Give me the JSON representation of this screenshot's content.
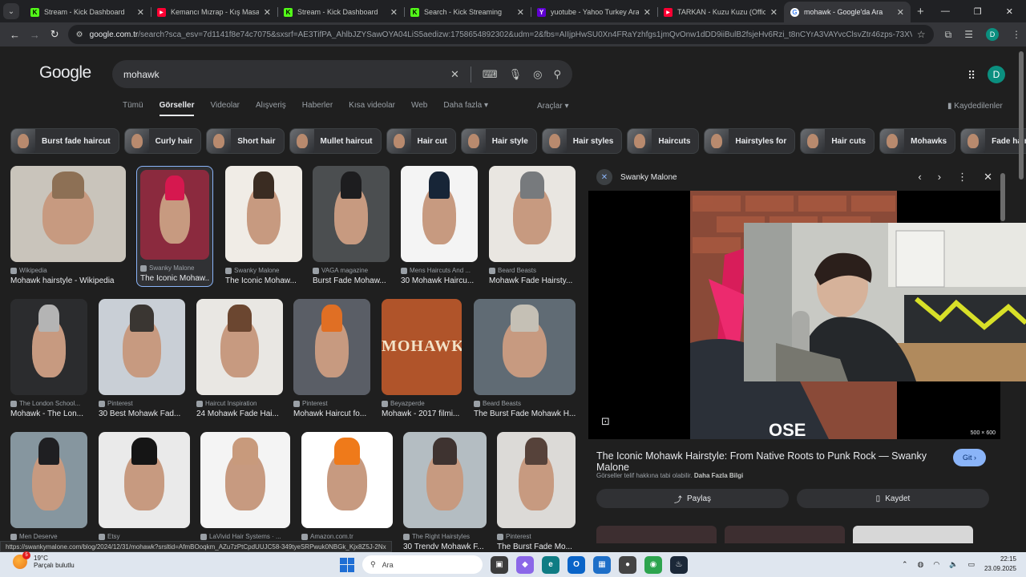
{
  "browser": {
    "tabs": [
      {
        "title": "Stream - Kick Dashboard",
        "icon": "kick-icon"
      },
      {
        "title": "Kemancı Mızrap - Kış Masalı - Y",
        "icon": "youtube-icon"
      },
      {
        "title": "Stream - Kick Dashboard",
        "icon": "kick-icon"
      },
      {
        "title": "Search - Kick Streaming",
        "icon": "kick-icon"
      },
      {
        "title": "yuotube - Yahoo Turkey Arama",
        "icon": "yahoo-icon"
      },
      {
        "title": "TARKAN - Kuzu Kuzu (Official M",
        "icon": "youtube-icon"
      },
      {
        "title": "mohawk - Google'da Ara",
        "icon": "google-icon",
        "active": true
      }
    ],
    "url_host": "google.com.tr",
    "url_rest": "/search?sca_esv=7d1141f8e74c7075&sxsrf=AE3TifPA_AhlbJZYSawOYA04LiS5aedizw:1758654892302&udm=2&fbs=AIIjpHwSU0Xn4FRaYzhfgs1jmQvOnw1dDD9iiBulB2fsjeHv6Rzi_t8nCYrA3VAYvcClsvZtr46zps-73XVWEL76eMkvfHLfzKUw...",
    "profile_letter": "D"
  },
  "google": {
    "logo": "Google",
    "query": "mohawk",
    "avatar_letter": "D",
    "nav_tabs": [
      "Tümü",
      "Görseller",
      "Videolar",
      "Alışveriş",
      "Haberler",
      "Kısa videolar",
      "Web",
      "Daha fazla ▾"
    ],
    "active_tab": "Görseller",
    "tools": "Araçlar ▾",
    "saved": "Kaydedilenler",
    "chips": [
      "Burst fade haircut",
      "Curly hair",
      "Short hair",
      "Mullet haircut",
      "Hair cut",
      "Hair style",
      "Hair styles",
      "Haircuts",
      "Hairstyles for",
      "Hair cuts",
      "Mohawks",
      "Fade haircuts"
    ]
  },
  "results": [
    {
      "source": "Wikipedia",
      "caption": "Mohawk hairstyle - Wikipedia"
    },
    {
      "source": "Swanky Malone",
      "caption": "The Iconic Mohaw..."
    },
    {
      "source": "Swanky Malone",
      "caption": "The Iconic Mohaw..."
    },
    {
      "source": "VAGA magazine",
      "caption": "Burst Fade Mohaw..."
    },
    {
      "source": "Mens Haircuts And ...",
      "caption": "30 Mohawk Haircu..."
    },
    {
      "source": "Beard Beasts",
      "caption": "Mohawk Fade Hairsty..."
    },
    {
      "source": "The London School...",
      "caption": "Mohawk - The Lon..."
    },
    {
      "source": "Pinterest",
      "caption": "30 Best Mohawk Fad..."
    },
    {
      "source": "Haircut Inspiration",
      "caption": "24 Mohawk Fade Hai..."
    },
    {
      "source": "Pinterest",
      "caption": "Mohawk Haircut fo..."
    },
    {
      "source": "Beyazperde",
      "caption": "Mohawk - 2017 filmi..."
    },
    {
      "source": "Beard Beasts",
      "caption": "The Burst Fade Mohawk H..."
    },
    {
      "source": "Men Deserve",
      "caption": ""
    },
    {
      "source": "Etsy",
      "caption": ""
    },
    {
      "source": "LaVivid Hair Systems · ...",
      "caption": ""
    },
    {
      "source": "Amazon.com.tr",
      "caption": ""
    },
    {
      "source": "The Right Hairstyles",
      "caption": "30 Trendy Mohawk F..."
    },
    {
      "source": "Pinterest",
      "caption": "The Burst Fade Mo..."
    }
  ],
  "poster_text": "MOHAWK",
  "panel": {
    "source": "Swanky Malone",
    "size": "500 × 600",
    "title": "The Iconic Mohawk Hairstyle: From Native Roots to Punk Rock — Swanky Malone",
    "visit": "Git",
    "rights": "Görseller telif hakkına tabi olabilir.",
    "rights_link": "Daha Fazla Bilgi",
    "share": "Paylaş",
    "save": "Kaydet"
  },
  "status_url": "https://swankymalone.com/blog/2024/12/31/mohawk?srsltid=AfmBOoqkm_AZu7zPtCpdUUJC58-349tyeSRPwuk0NBGk_Kjx8Z5J-2Nx",
  "taskbar": {
    "temp": "19°C",
    "weather": "Parçalı bulutlu",
    "badge": "5",
    "search": "Ara",
    "time": "22:15",
    "date": "23.09.2025"
  }
}
